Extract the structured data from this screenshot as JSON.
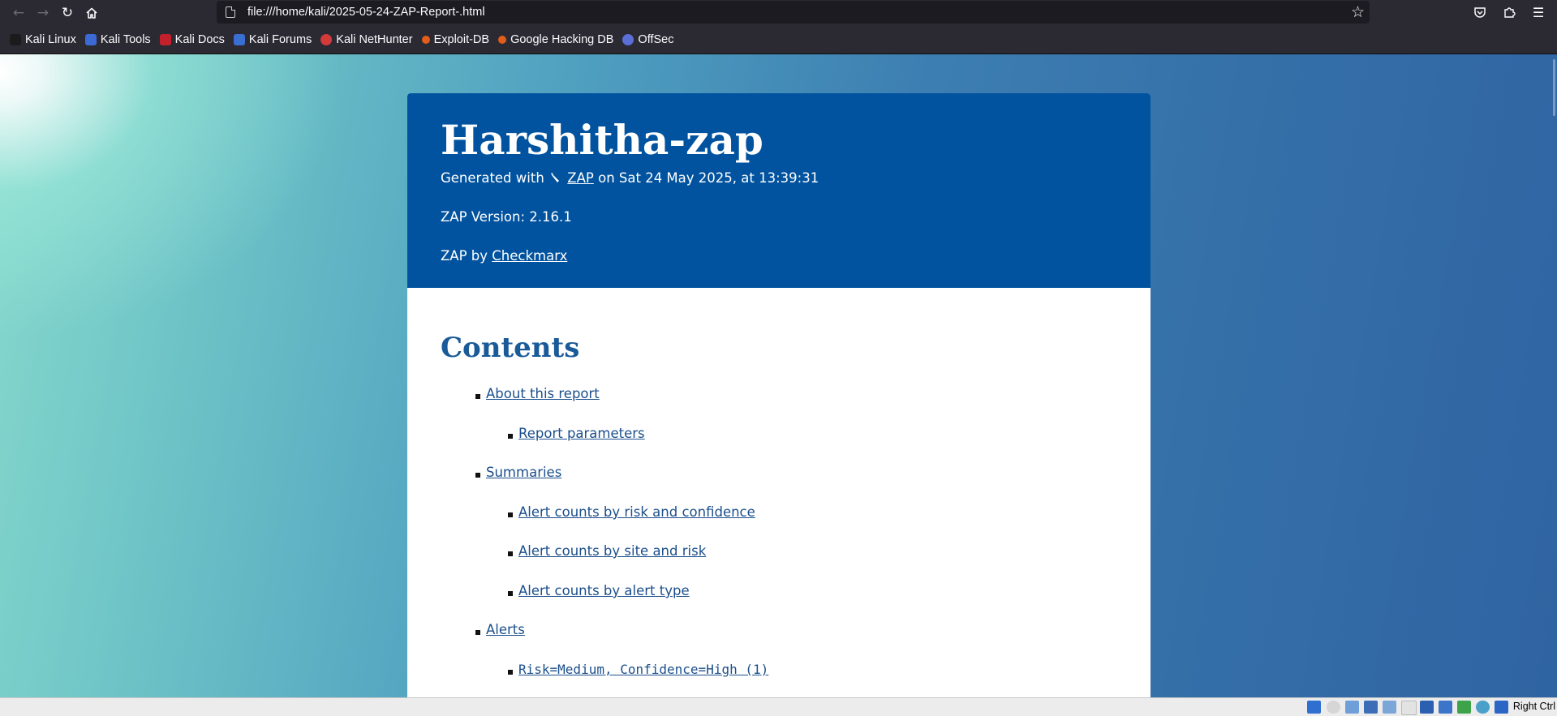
{
  "browser": {
    "url": "file:///home/kali/2025-05-24-ZAP-Report-.html",
    "bookmarks": [
      {
        "label": "Kali Linux",
        "icon": "kali-dragon-icon",
        "color": "#1b1b1b"
      },
      {
        "label": "Kali Tools",
        "icon": "kali-tools-icon",
        "color": "#3b6ad6"
      },
      {
        "label": "Kali Docs",
        "icon": "kali-docs-icon",
        "color": "#c4202b"
      },
      {
        "label": "Kali Forums",
        "icon": "kali-forums-icon",
        "color": "#3a6fd1"
      },
      {
        "label": "Kali NetHunter",
        "icon": "nethunter-icon",
        "color": "#d33a3a"
      },
      {
        "label": "Exploit-DB",
        "icon": "exploit-db-icon",
        "color": "#e25d1a"
      },
      {
        "label": "Google Hacking DB",
        "icon": "ghdb-icon",
        "color": "#e25d1a"
      },
      {
        "label": "OffSec",
        "icon": "offsec-icon",
        "color": "#5b6fd6"
      }
    ]
  },
  "report": {
    "title": "Harshitha-zap",
    "generated_prefix": "Generated with",
    "generated_link": "ZAP",
    "generated_suffix": "on Sat 24 May 2025, at 13:39:31",
    "version_line": "ZAP Version: 2.16.1",
    "by_prefix": "ZAP by",
    "by_link": "Checkmarx",
    "header_color": "#01539f"
  },
  "contents": {
    "title": "Contents",
    "items": [
      {
        "label": "About this report",
        "level": 1
      },
      {
        "label": "Report parameters",
        "level": 2
      },
      {
        "label": "Summaries",
        "level": 1
      },
      {
        "label": "Alert counts by risk and confidence",
        "level": 2
      },
      {
        "label": "Alert counts by site and risk",
        "level": 2
      },
      {
        "label": "Alert counts by alert type",
        "level": 2
      },
      {
        "label": "Alerts",
        "level": 1
      },
      {
        "label": "Risk=Medium, Confidence=High (1)",
        "level": 2
      }
    ]
  },
  "statusbar": {
    "host_key": "Right Ctrl"
  }
}
